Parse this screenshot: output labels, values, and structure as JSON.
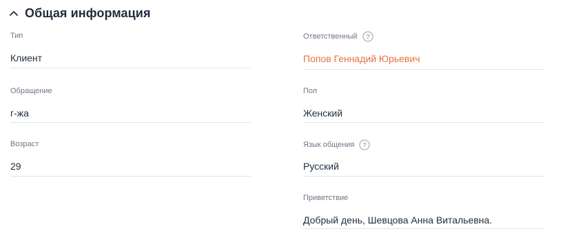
{
  "section": {
    "title": "Общая информация",
    "toggle_icon": "chevron-up-icon"
  },
  "fields": {
    "type": {
      "label": "Тип",
      "value": "Клиент"
    },
    "responsible": {
      "label": "Ответственный",
      "value": "Попов Геннадий Юрьевич",
      "help_icon": "question-circle-icon",
      "value_color": "#e8703e"
    },
    "salutation": {
      "label": "Обращение",
      "value": "г-жа"
    },
    "gender": {
      "label": "Пол",
      "value": "Женский"
    },
    "age": {
      "label": "Возраст",
      "value": "29"
    },
    "language": {
      "label": "Язык общения",
      "value": "Русский",
      "help_icon": "question-circle-icon"
    },
    "greeting": {
      "label": "Приветствие",
      "value": "Добрый день, Шевцова Анна Витальевна."
    }
  }
}
